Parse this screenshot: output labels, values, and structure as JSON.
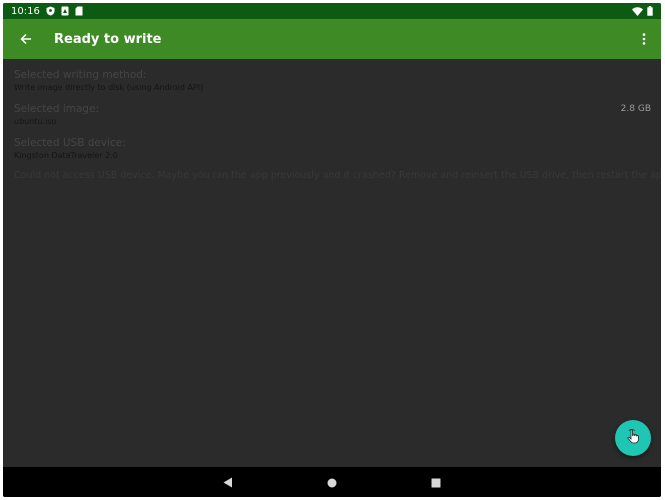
{
  "status_bar": {
    "time": "10:16",
    "icons": [
      "shield-icon",
      "sim-card-icon",
      "sd-card-icon",
      "wifi-icon",
      "battery-icon"
    ]
  },
  "app_bar": {
    "title": "Ready to write",
    "back_icon": "arrow-back-icon",
    "menu_icon": "more-vert-icon",
    "background": "#3e8a25"
  },
  "writing_method": {
    "label": "Selected writing method:",
    "value": "Write image directly to disk (using Android API)"
  },
  "image": {
    "label": "Selected image:",
    "value": "ubuntu.iso",
    "size": "2.8 GB"
  },
  "usb_device": {
    "label": "Selected USB device:",
    "value": "Kingston DataTraveler 2.0"
  },
  "error_message": "Could not access USB device. Maybe you ran the app previously and it crashed? Remove and reinsert the USB drive, then restart the app.",
  "fab": {
    "icon": "touch-hand-icon",
    "color": "#1fc6b3"
  },
  "nav_bar": {
    "icons": [
      "nav-back-icon",
      "nav-home-icon",
      "nav-recents-icon"
    ]
  }
}
